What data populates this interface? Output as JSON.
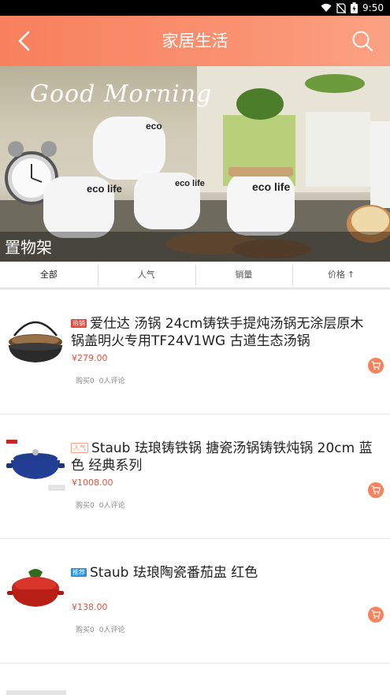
{
  "status_bar": {
    "time": "9:50"
  },
  "header": {
    "title": "家居生活",
    "back_icon": "back-arrow-icon",
    "search_icon": "search-icon"
  },
  "banner": {
    "caption": "置物架",
    "overlay_text": "Good Morning",
    "mug_text": "eco life"
  },
  "tabs": [
    {
      "label": "全部",
      "active": true
    },
    {
      "label": "人气"
    },
    {
      "label": "销量"
    },
    {
      "label": "价格",
      "arrow": "↑"
    }
  ],
  "products": [
    {
      "tag": "热销",
      "title": "爱仕达 汤锅 24cm铸铁手提炖汤锅无涂层原木锅盖明火专用TF24V1WG 古道生态汤锅",
      "price": "¥279.00",
      "bought": "购买0",
      "reviews": "0人评论"
    },
    {
      "tag": "人气",
      "title": "Staub 珐琅铸铁锅 搪瓷汤锅铸铁炖锅 20cm 蓝色 经典系列",
      "price": "¥1008.00",
      "bought": "购买0",
      "reviews": "0人评论"
    },
    {
      "tag": "推荐",
      "title": "Staub 珐琅陶瓷番茄盅 红色",
      "price": "¥138.00",
      "bought": "购买0",
      "reviews": "0人评论"
    }
  ],
  "colors": {
    "accent": "#f8805e",
    "price": "#e4533e",
    "hot_tag": "#e0463c",
    "rec_tag": "#2c8fd8"
  }
}
